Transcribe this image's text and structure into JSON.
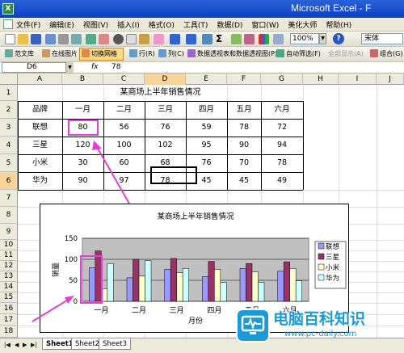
{
  "window": {
    "title": "Microsoft Excel - F"
  },
  "menu": [
    "文件(F)",
    "编辑(E)",
    "视图(V)",
    "插入(I)",
    "格式(O)",
    "工具(T)",
    "数据(D)",
    "窗口(W)",
    "美化大师",
    "帮助(H)"
  ],
  "toolbar": {
    "zoom": "100%",
    "font": "宋体",
    "sigma": "Σ",
    "help": "?"
  },
  "toolbar2": {
    "items": [
      "范文库",
      "在线图片",
      "切换网格",
      "行(R)",
      "列(C)",
      "数据透视表和数据透视图(P)...",
      "自动筛选(F)",
      "全部显示(A)",
      "组合(G)"
    ]
  },
  "formula_bar": {
    "name_box": "D6",
    "fx": "fx",
    "value": "78"
  },
  "columns": [
    "A",
    "B",
    "C",
    "D",
    "E",
    "F",
    "G",
    "H",
    "I",
    "J"
  ],
  "rows": [
    "1",
    "2",
    "3",
    "4",
    "5",
    "6",
    "7",
    "8",
    "9",
    "10",
    "11",
    "12",
    "13",
    "14",
    "15",
    "16",
    "17",
    "18"
  ],
  "table": {
    "title": "某商场上半年销售情况",
    "header": [
      "品牌",
      "一月",
      "二月",
      "三月",
      "四月",
      "五月",
      "六月"
    ],
    "rows": [
      [
        "联想",
        "80",
        "56",
        "76",
        "59",
        "78",
        "72"
      ],
      [
        "三星",
        "120",
        "100",
        "102",
        "95",
        "90",
        "94"
      ],
      [
        "小米",
        "30",
        "60",
        "68",
        "76",
        "70",
        "78"
      ],
      [
        "华为",
        "90",
        "97",
        "78",
        "45",
        "45",
        "49"
      ]
    ]
  },
  "chart_data": {
    "type": "bar",
    "title": "某商场上半年销售情况",
    "categories": [
      "一月",
      "二月",
      "三月",
      "四月",
      "五月",
      "六月"
    ],
    "series": [
      {
        "name": "联想",
        "values": [
          80,
          56,
          76,
          59,
          78,
          72
        ],
        "color": "#9999ff"
      },
      {
        "name": "三星",
        "values": [
          120,
          100,
          102,
          95,
          90,
          94
        ],
        "color": "#993366"
      },
      {
        "name": "小米",
        "values": [
          30,
          60,
          68,
          76,
          70,
          78
        ],
        "color": "#ffffcc"
      },
      {
        "name": "华为",
        "values": [
          90,
          97,
          78,
          45,
          45,
          49
        ],
        "color": "#ccffff"
      }
    ],
    "xlabel": "月份",
    "ylabel": "销量",
    "ylim": [
      0,
      150
    ],
    "yticks": [
      "0",
      "50",
      "100",
      "150"
    ],
    "grid": true,
    "plot_background": "#c0c0c0",
    "legend": "right"
  },
  "sheets": [
    "Sheet1",
    "Sheet2",
    "Sheet3"
  ],
  "active_sheet": "Sheet1",
  "watermark": {
    "name": "电脑百科知识",
    "url": "www.pc-daily.com"
  },
  "colors": {
    "highlight": "#e040d8",
    "selected_header": "#f8d49b",
    "titlebar": "#0a3fc0"
  }
}
